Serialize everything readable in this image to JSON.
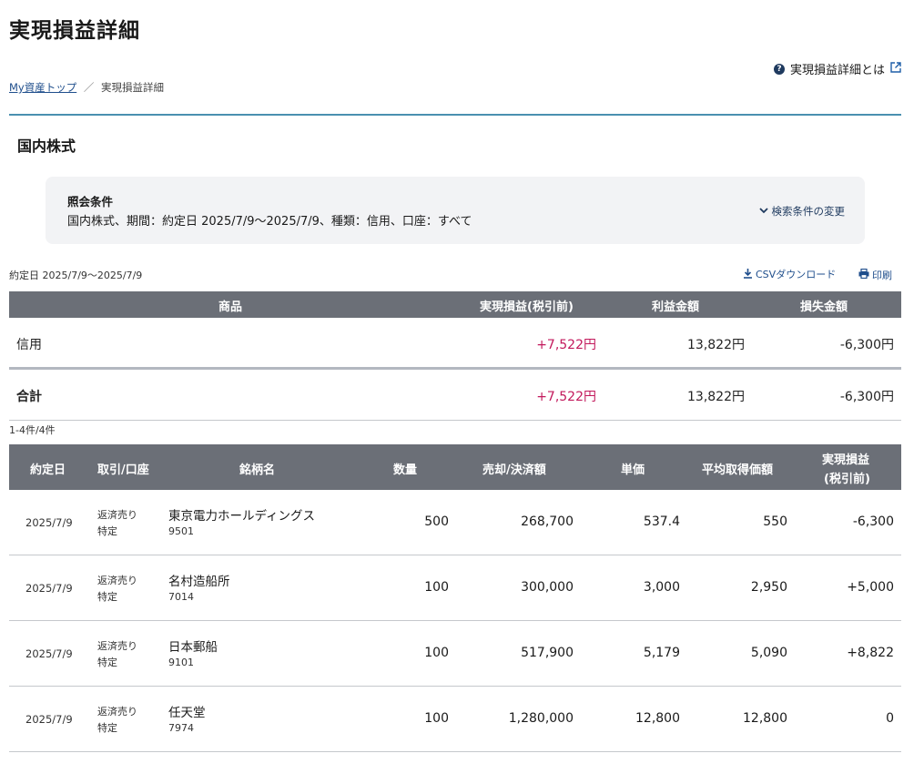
{
  "header": {
    "title": "実現損益詳細",
    "help_label": "実現損益詳細とは",
    "help_icon": "question-icon",
    "external_icon": "external-link-icon"
  },
  "breadcrumb": {
    "home": "My資産トップ",
    "separator": "／",
    "current": "実現損益詳細"
  },
  "section": {
    "title": "国内株式"
  },
  "conditions": {
    "label": "照会条件",
    "text": "国内株式、期間：約定日 2025/7/9〜2025/7/9、種類：信用、口座：すべて",
    "change_label": "検索条件の変更",
    "change_icon": "chevron-down-icon"
  },
  "toolbar": {
    "date_range": "約定日 2025/7/9〜2025/7/9",
    "csv_label": "CSVダウンロード",
    "csv_icon": "download-icon",
    "print_label": "印刷",
    "print_icon": "printer-icon"
  },
  "summary": {
    "headers": [
      "商品",
      "実現損益(税引前)",
      "利益金額",
      "損失金額"
    ],
    "rows": [
      {
        "product": "信用",
        "pl": "+7,522円",
        "profit": "13,822円",
        "loss": "-6,300円"
      },
      {
        "product": "合計",
        "pl": "+7,522円",
        "profit": "13,822円",
        "loss": "-6,300円"
      }
    ]
  },
  "detail": {
    "count": "1-4件/4件",
    "headers": {
      "date": "約定日",
      "trade": "取引/口座",
      "name": "銘柄名",
      "qty": "数量",
      "amount": "売却/決済額",
      "price": "単価",
      "avg": "平均取得価額",
      "pl_line1": "実現損益",
      "pl_line2": "(税引前)"
    },
    "rows": [
      {
        "date": "2025/7/9",
        "trade": "返済売り",
        "account": "特定",
        "name": "東京電力ホールディングス",
        "code": "9501",
        "qty": "500",
        "amount": "268,700",
        "price": "537.4",
        "avg": "550",
        "pl": "-6,300"
      },
      {
        "date": "2025/7/9",
        "trade": "返済売り",
        "account": "特定",
        "name": "名村造船所",
        "code": "7014",
        "qty": "100",
        "amount": "300,000",
        "price": "3,000",
        "avg": "2,950",
        "pl": "+5,000"
      },
      {
        "date": "2025/7/9",
        "trade": "返済売り",
        "account": "特定",
        "name": "日本郵船",
        "code": "9101",
        "qty": "100",
        "amount": "517,900",
        "price": "5,179",
        "avg": "5,090",
        "pl": "+8,822"
      },
      {
        "date": "2025/7/9",
        "trade": "返済売り",
        "account": "特定",
        "name": "任天堂",
        "code": "7974",
        "qty": "100",
        "amount": "1,280,000",
        "price": "12,800",
        "avg": "12,800",
        "pl": "0"
      }
    ]
  },
  "colors": {
    "header_bg": "#6b6f77",
    "accent_rule": "#4a90b0",
    "positive": "#c2185b",
    "negative": "#2a7f85",
    "link": "#1f4e8c"
  }
}
